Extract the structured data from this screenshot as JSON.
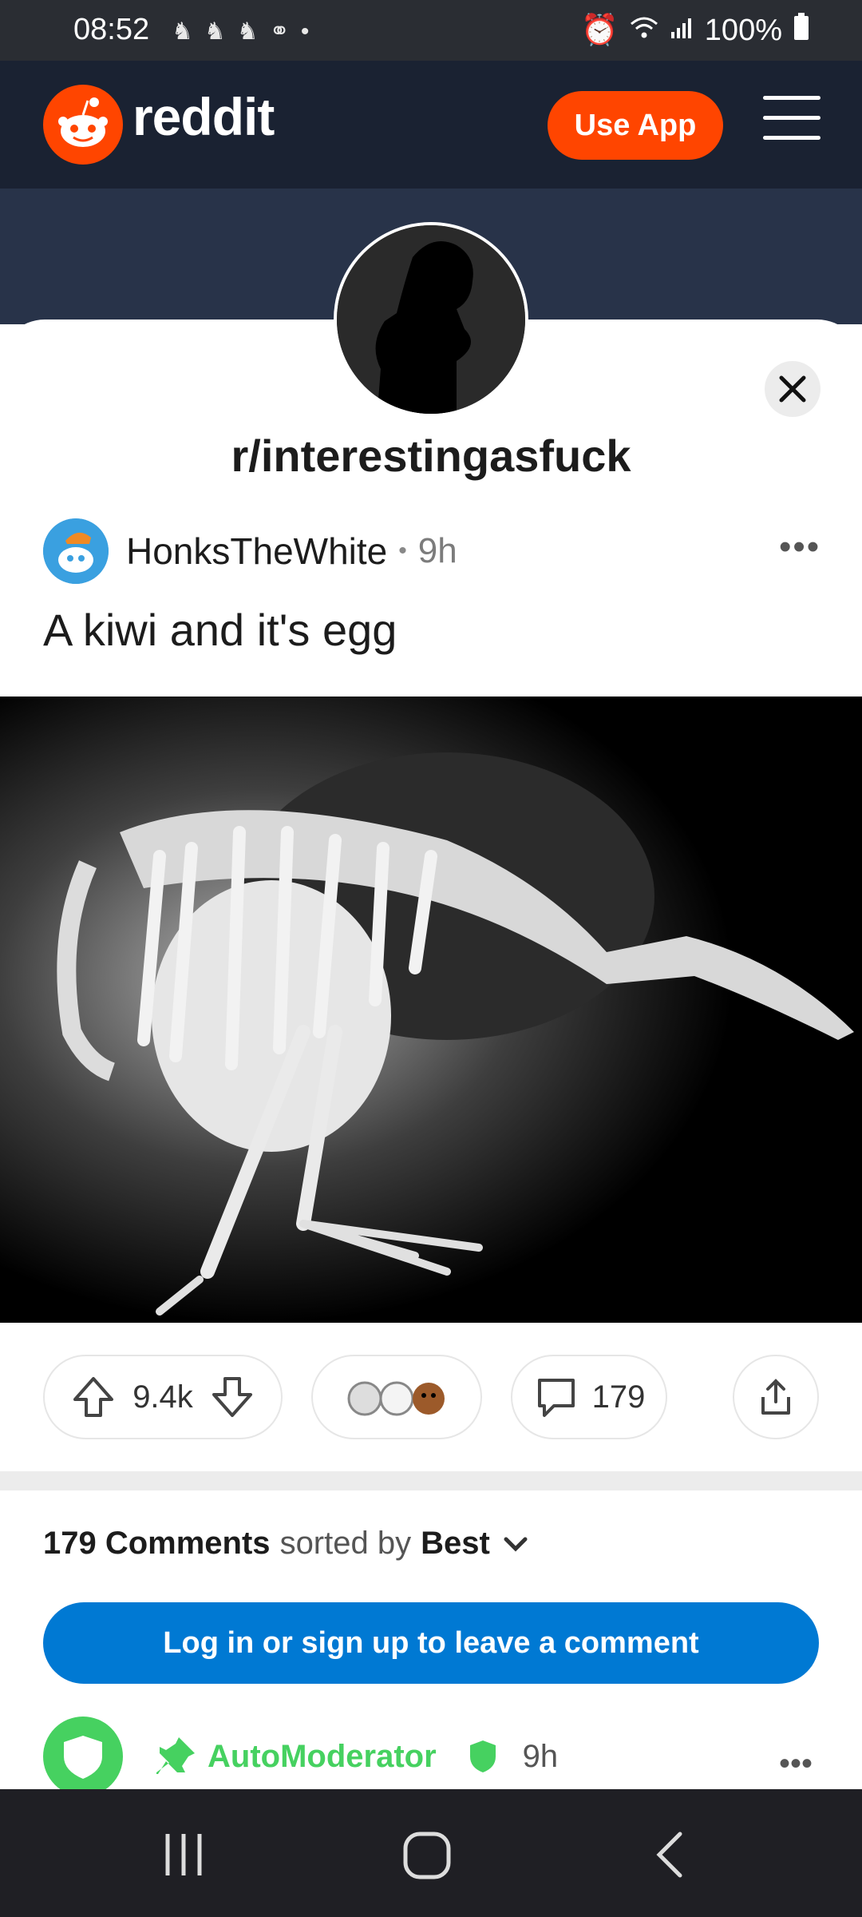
{
  "status_bar": {
    "time": "08:52",
    "notifications": "•",
    "battery": "100%",
    "icons": [
      "alarm-icon",
      "wifi-icon",
      "signal-icon",
      "battery-icon"
    ]
  },
  "header": {
    "brand": "reddit",
    "use_app": "Use App"
  },
  "subreddit": {
    "name": "r/interestingasfuck"
  },
  "post": {
    "author": "HonksTheWhite",
    "age": "9h",
    "title": "A kiwi and it's egg"
  },
  "actions": {
    "votes": "9.4k",
    "comments": "179"
  },
  "comments_section": {
    "count_label": "179 Comments",
    "sorted_by": "sorted by",
    "sort_value": "Best",
    "login_cta": "Log in or sign up to leave a comment"
  },
  "first_comment": {
    "author": "AutoModerator",
    "age": "9h"
  },
  "colors": {
    "brand": "#ff4500",
    "header_bg": "#1a2232",
    "cta_blue": "#0079d3",
    "mod_green": "#46d160"
  }
}
